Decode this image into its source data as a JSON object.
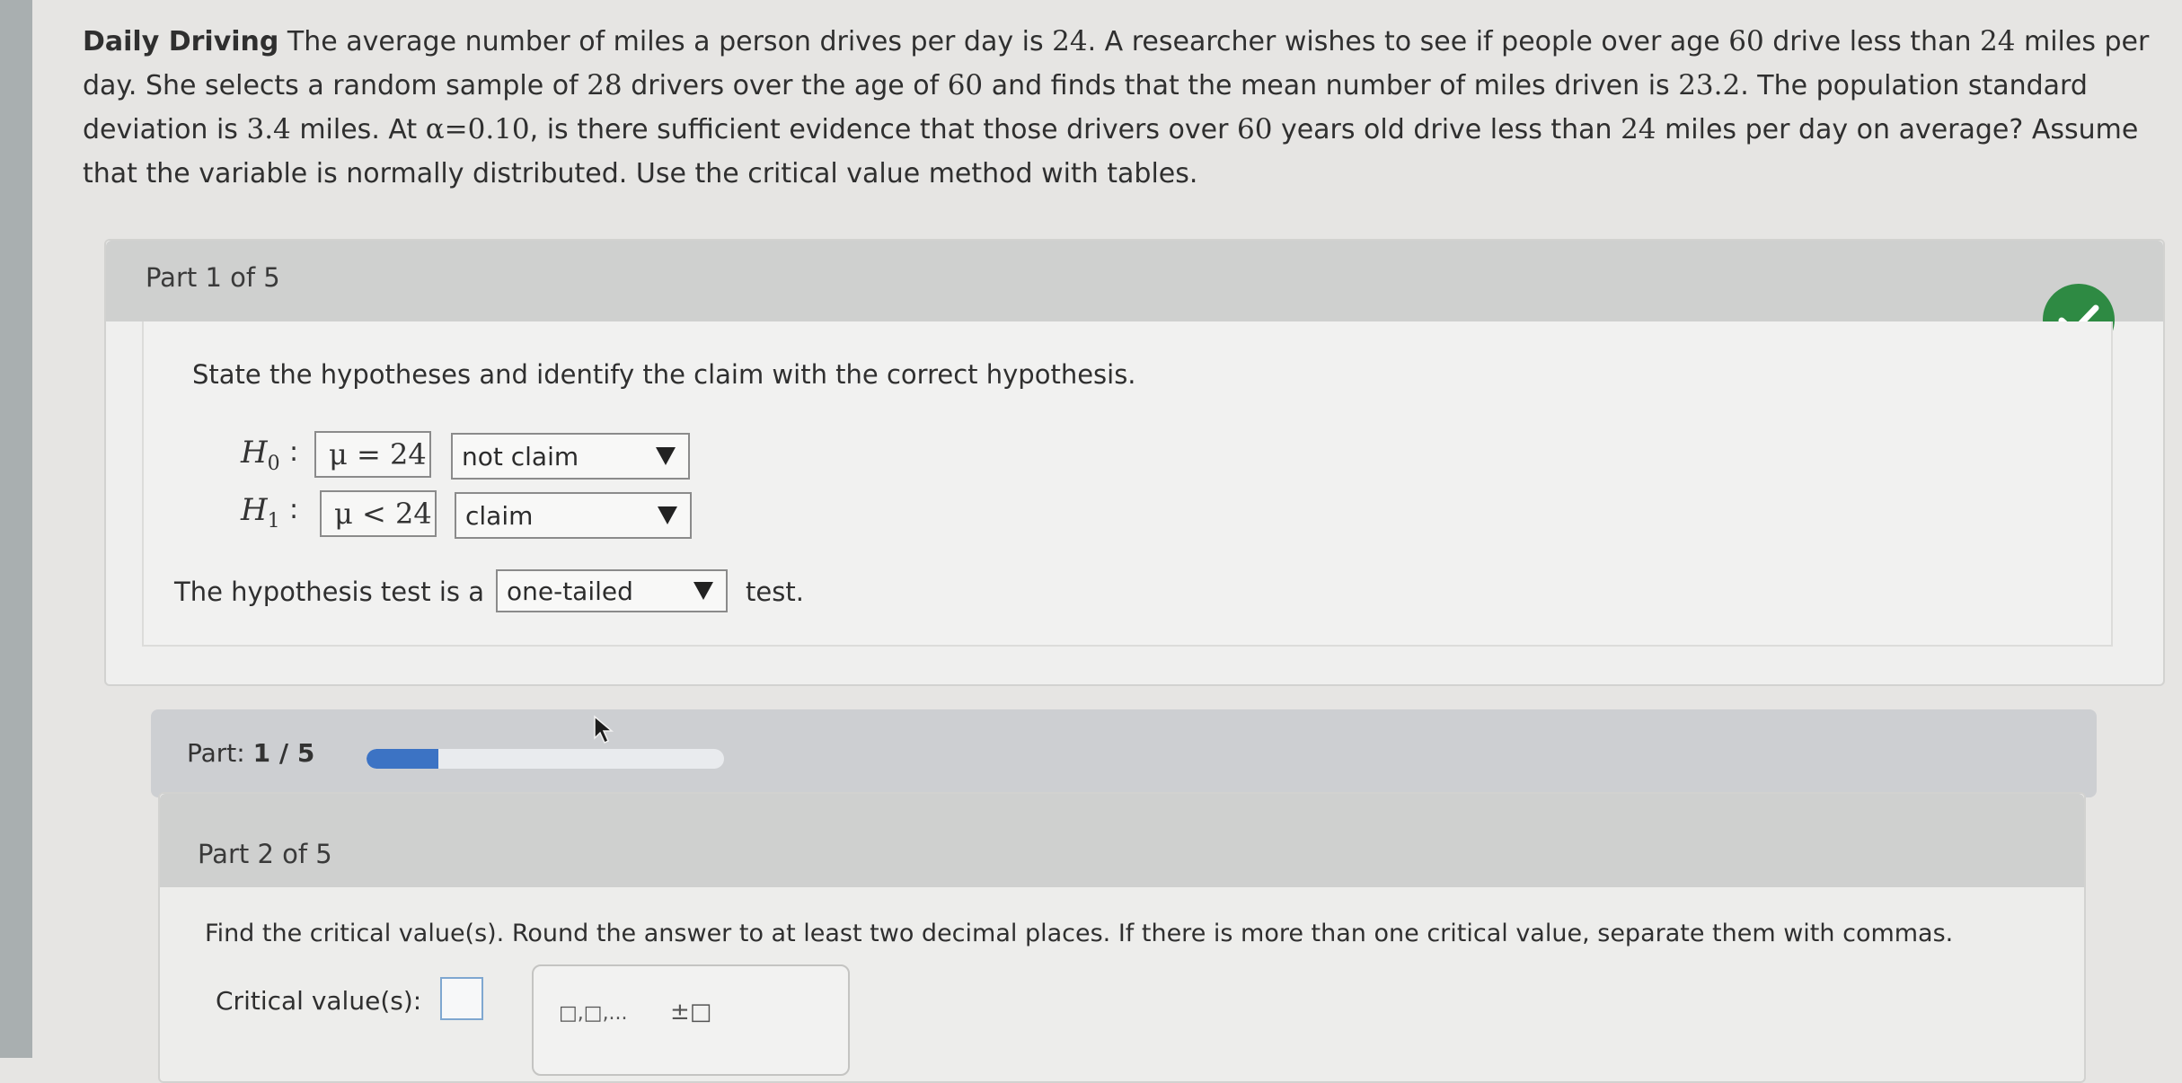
{
  "problem": {
    "title": "Daily Driving",
    "t1": " The average number of miles a person drives per day is ",
    "n1": "24",
    "t2": ". A researcher wishes to see if people over age ",
    "n2": "60",
    "t3": " drive less than ",
    "n3": "24",
    "t4": " miles per day. She selects a random sample of ",
    "n4": "28",
    "t5": " drivers over the age of ",
    "n5": "60",
    "t6": " and finds that the mean number of miles driven is ",
    "n6": "23.2",
    "t7": ". The population standard deviation is ",
    "n7": "3.4",
    "t8": " miles. At ",
    "n8": "α=0.10",
    "t9": ", is there sufficient evidence that those drivers over ",
    "n9": "60",
    "t10": " years old drive less than ",
    "n10": "24",
    "t11": " miles per day on average? Assume that the variable is normally distributed. Use the critical value method with tables."
  },
  "part1": {
    "header": "Part 1 of 5",
    "prompt": "State the hypotheses and identify the claim with the correct hypothesis.",
    "h0_symbol": "H",
    "h0_sub": "0",
    "h1_symbol": "H",
    "h1_sub": "1",
    "colon": ":",
    "h0_value": "μ = 24",
    "h0_claim": "not claim",
    "h1_value": "μ < 24",
    "h1_claim": "claim",
    "test_prefix": "The hypothesis test is a",
    "test_type": "one-tailed",
    "test_suffix": "test.",
    "status": "correct"
  },
  "progress": {
    "label": "Part:",
    "value": "1 / 5",
    "fraction": 0.2
  },
  "part2": {
    "header": "Part 2 of 5",
    "prompt": "Find the critical value(s). Round the answer to at least two decimal places. If there is more than one critical value, separate them with commas.",
    "label": "Critical value(s):",
    "value": "",
    "palette": [
      "□,□,...",
      "±□"
    ]
  },
  "colors": {
    "accent_blue": "#3c73c4",
    "check_green": "#2e8a43",
    "header_gray": "#cfd0cf"
  }
}
